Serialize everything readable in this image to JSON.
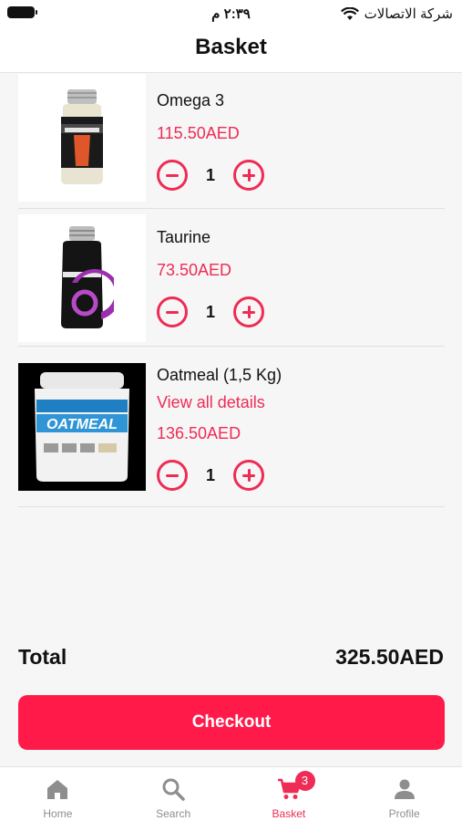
{
  "status_bar": {
    "time": "٢:٣٩ م",
    "carrier": "شركة الاتصالات",
    "icons": [
      "battery-icon",
      "wifi-icon"
    ]
  },
  "header": {
    "title": "Basket"
  },
  "items": [
    {
      "name": "Omega 3",
      "price": "115.50AED",
      "quantity": "1",
      "image_icon": "omega3-supplement-bottle"
    },
    {
      "name": "Taurine",
      "price": "73.50AED",
      "quantity": "1",
      "image_icon": "taurine-supplement-bottle"
    },
    {
      "name": "Oatmeal (1,5 Kg)",
      "details_link": "View all details",
      "price": "136.50AED",
      "quantity": "1",
      "image_icon": "oatmeal-tub"
    }
  ],
  "summary": {
    "total_label": "Total",
    "total_value": "325.50AED"
  },
  "checkout": {
    "label": "Checkout"
  },
  "tabs": [
    {
      "label": "Home",
      "icon": "home-icon"
    },
    {
      "label": "Search",
      "icon": "search-icon"
    },
    {
      "label": "Basket",
      "icon": "cart-icon",
      "badge": "3",
      "active": true
    },
    {
      "label": "Profile",
      "icon": "profile-icon"
    }
  ],
  "colors": {
    "accent": "#ee2c55",
    "checkout": "#ff1a4a",
    "inactive": "#8e8e8e"
  }
}
